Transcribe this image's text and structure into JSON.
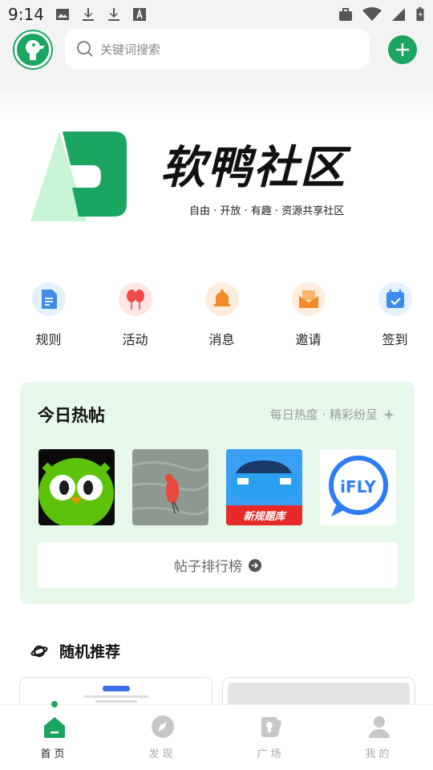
{
  "status_bar": {
    "time": "9:14"
  },
  "search": {
    "placeholder": "关键词搜索"
  },
  "banner": {
    "title": "软鸭社区",
    "subtitle": "自由 · 开放 · 有趣 · 资源共享社区"
  },
  "quick_nav": [
    {
      "label": "规则",
      "icon": "document-icon",
      "color": "#3b8de8"
    },
    {
      "label": "活动",
      "icon": "balloons-icon",
      "color": "#f04a4a"
    },
    {
      "label": "消息",
      "icon": "bell-icon",
      "color": "#f58a2a"
    },
    {
      "label": "邀请",
      "icon": "envelope-icon",
      "color": "#f58a2a"
    },
    {
      "label": "签到",
      "icon": "calendar-check-icon",
      "color": "#3b8de8"
    }
  ],
  "hot_posts": {
    "title": "今日热帖",
    "subtitle": "每日热度 · 精彩纷呈",
    "thumbs": [
      {
        "name": "duolingo-owl",
        "caption": ""
      },
      {
        "name": "bird-photo",
        "caption": ""
      },
      {
        "name": "car-quiz-app",
        "caption": "新规题库"
      },
      {
        "name": "ifly-app",
        "caption": "iFLY"
      }
    ],
    "rank_button": "帖子排行榜"
  },
  "random": {
    "title": "随机推荐"
  },
  "bottom_nav": [
    {
      "label": "首页",
      "icon": "home-icon",
      "active": true
    },
    {
      "label": "发现",
      "icon": "compass-icon",
      "active": false
    },
    {
      "label": "广场",
      "icon": "square-icon",
      "active": false
    },
    {
      "label": "我的",
      "icon": "user-icon",
      "active": false
    }
  ],
  "colors": {
    "brand": "#1aa560",
    "card_bg": "#e6f8ea"
  }
}
